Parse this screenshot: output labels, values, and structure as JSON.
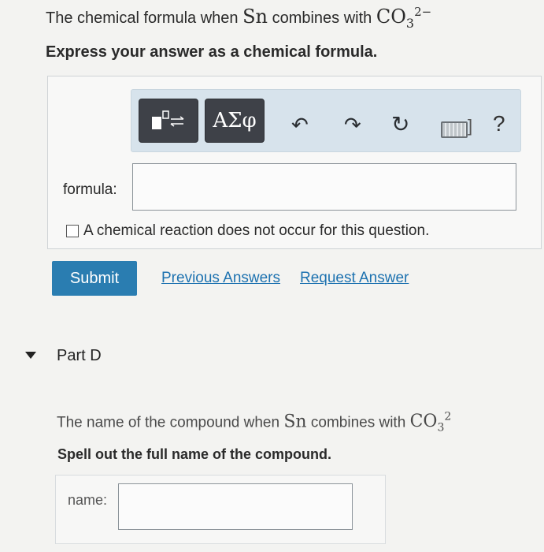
{
  "partC": {
    "question_text": "The chemical formula when ",
    "element": "Sn",
    "question_mid": " combines with ",
    "ion": "CO",
    "ion_sub": "3",
    "ion_sup": "2−",
    "instruction": "Express your answer as a chemical formula.",
    "toolbar": {
      "symbols_label": "ΑΣφ",
      "undo_icon": "↶",
      "redo_icon": "↷",
      "reset_icon": "↻",
      "keyboard_bracket": "]",
      "help_label": "?"
    },
    "formula_label": "formula:",
    "formula_value": "",
    "no_reaction_label": "A chemical reaction does not occur for this question.",
    "submit_label": "Submit",
    "previous_answers_label": "Previous Answers",
    "request_answer_label": "Request Answer"
  },
  "partD": {
    "title": "Part D",
    "question_text": "The name of the compound when ",
    "element": "Sn",
    "question_mid": " combines with ",
    "ion": "CO",
    "ion_sub": "3",
    "ion_sup": "2",
    "instruction": "Spell out the full name of the compound.",
    "name_label": "name:",
    "name_value": ""
  },
  "colors": {
    "accent": "#2a7db1",
    "link": "#1d72b0",
    "toolbar_bg": "#d7e3ec",
    "button_dark": "#3e4148"
  }
}
